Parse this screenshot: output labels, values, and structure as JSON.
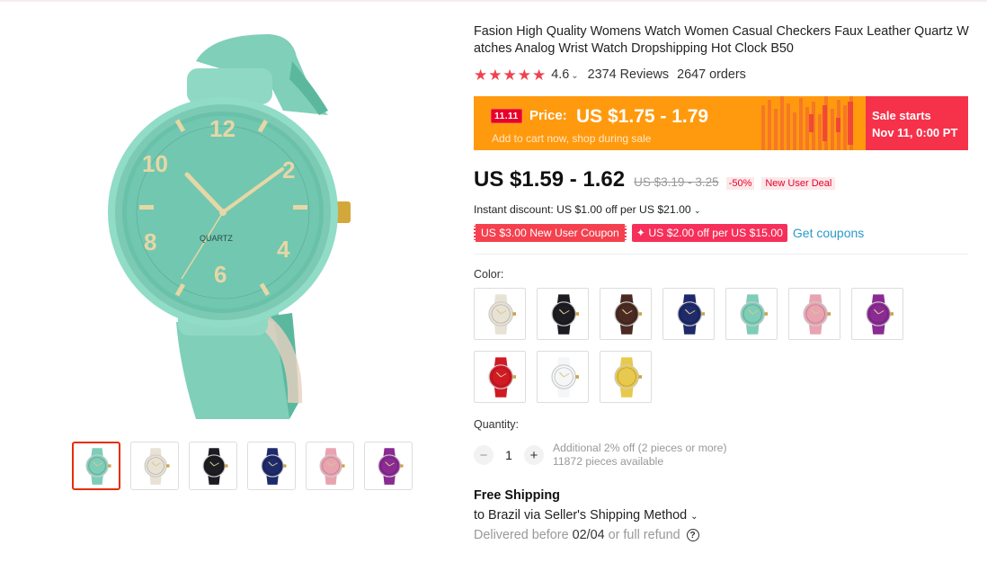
{
  "product": {
    "title": "Fasion High Quality Womens Watch Women Casual Checkers Faux Leather Quartz Watches Analog Wrist Watch Dropshipping Hot Clock B50",
    "rating": "4.6",
    "reviews": "2374 Reviews",
    "orders": "2647 orders",
    "dial_text": "QUARTZ"
  },
  "promo": {
    "badge": "11.11",
    "price_label": "Price:",
    "price_value": "US $1.75 - 1.79",
    "subtext": "Add to cart now, shop during sale",
    "sale_line1": "Sale starts",
    "sale_line2": "Nov 11, 0:00 PT"
  },
  "price": {
    "current": "US $1.59 - 1.62",
    "original": "US $3.19 - 3.25",
    "discount": "-50%",
    "new_user_deal": "New User Deal"
  },
  "instant_discount": "Instant discount: US $1.00 off per US $21.00",
  "coupons": {
    "coupon1": "US $3.00 New User Coupon",
    "coupon2": "✦ US $2.00 off per US $15.00",
    "get_coupons": "Get coupons"
  },
  "color_label": "Color:",
  "colors": [
    {
      "name": "beige",
      "hex": "#e8e2d4"
    },
    {
      "name": "black",
      "hex": "#1c1c22"
    },
    {
      "name": "brown",
      "hex": "#4a2a22"
    },
    {
      "name": "navy",
      "hex": "#1e2a6a"
    },
    {
      "name": "mint",
      "hex": "#7ecdb8"
    },
    {
      "name": "pink",
      "hex": "#e9a3b0"
    },
    {
      "name": "purple",
      "hex": "#8a2a92"
    },
    {
      "name": "red",
      "hex": "#d01a24"
    },
    {
      "name": "white",
      "hex": "#f4f6f8"
    },
    {
      "name": "yellow",
      "hex": "#e8c94a"
    }
  ],
  "thumbnails": [
    {
      "name": "mint",
      "hex": "#7ecdb8"
    },
    {
      "name": "beige",
      "hex": "#e8e2d4"
    },
    {
      "name": "black",
      "hex": "#1c1c22"
    },
    {
      "name": "navy",
      "hex": "#1e2a6a"
    },
    {
      "name": "pink",
      "hex": "#e9a3b0"
    },
    {
      "name": "purple",
      "hex": "#8a2a92"
    }
  ],
  "quantity": {
    "label": "Quantity:",
    "value": "1",
    "minus": "−",
    "plus": "+",
    "note": "Additional 2% off (2 pieces or more)",
    "available": "11872 pieces available"
  },
  "shipping": {
    "title": "Free Shipping",
    "via": "to Brazil via Seller's Shipping Method",
    "delivered_prefix": "Delivered before",
    "delivered_date": "02/04",
    "delivered_suffix": "or full refund",
    "help_icon": "?"
  },
  "icons": {
    "star": "★",
    "chevron": "⌄"
  }
}
